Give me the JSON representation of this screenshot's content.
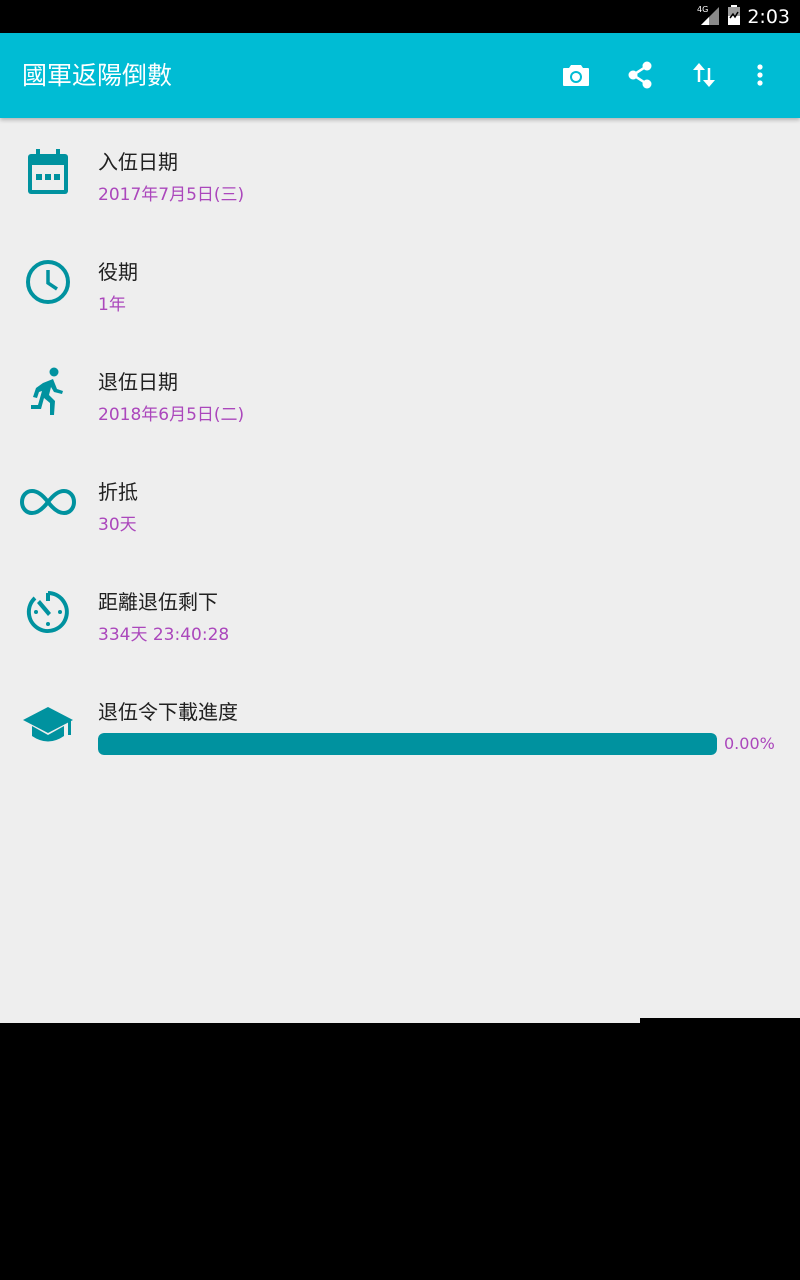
{
  "status_bar": {
    "network": "4G",
    "time": "2:03"
  },
  "app_bar": {
    "title": "國軍返陽倒數",
    "actions": [
      {
        "name": "camera",
        "icon": "camera-icon"
      },
      {
        "name": "share",
        "icon": "share-icon"
      },
      {
        "name": "sort",
        "icon": "swap-vertical-icon"
      },
      {
        "name": "more",
        "icon": "more-vert-icon"
      }
    ]
  },
  "items": [
    {
      "icon": "calendar-icon",
      "title": "入伍日期",
      "value": "2017年7月5日(三)"
    },
    {
      "icon": "clock-icon",
      "title": "役期",
      "value": "1年"
    },
    {
      "icon": "running-person-icon",
      "title": "退伍日期",
      "value": "2018年6月5日(二)"
    },
    {
      "icon": "infinity-icon",
      "title": "折抵",
      "value": "30天"
    },
    {
      "icon": "timer-icon",
      "title": "距離退伍剩下",
      "value": "334天 23:40:28"
    },
    {
      "icon": "graduation-cap-icon",
      "title": "退伍令下載進度"
    }
  ],
  "progress": {
    "percent": 0,
    "label": "0.00%"
  },
  "colors": {
    "app_bar": "#00bcd4",
    "icon": "#00929f",
    "value_text": "#ab47bc",
    "background": "#eeeeee"
  }
}
